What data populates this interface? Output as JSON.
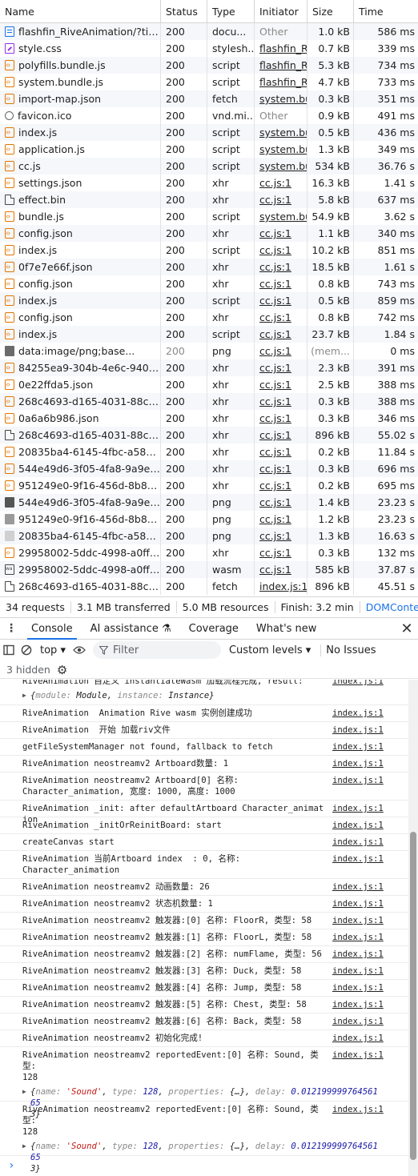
{
  "network": {
    "columns": [
      "Name",
      "Status",
      "Type",
      "Initiator",
      "Size",
      "Time"
    ],
    "rows": [
      {
        "icon": "document-icon",
        "name": "flashfin_RiveAnimation/?tim...",
        "status": "200",
        "type": "docu...",
        "initiator": "Other",
        "size": "1.0 kB",
        "time": "586 ms",
        "gray": true
      },
      {
        "icon": "css-icon",
        "name": "style.css",
        "status": "200",
        "type": "stylesh...",
        "initiator": "flashfin_Riv",
        "size": "0.7 kB",
        "time": "339 ms"
      },
      {
        "icon": "script-icon",
        "name": "polyfills.bundle.js",
        "status": "200",
        "type": "script",
        "initiator": "flashfin_Riv",
        "size": "5.3 kB",
        "time": "734 ms"
      },
      {
        "icon": "script-icon",
        "name": "system.bundle.js",
        "status": "200",
        "type": "script",
        "initiator": "flashfin_Riv",
        "size": "4.7 kB",
        "time": "733 ms"
      },
      {
        "icon": "script-icon",
        "name": "import-map.json",
        "status": "200",
        "type": "fetch",
        "initiator": "system.bun",
        "size": "0.3 kB",
        "time": "351 ms"
      },
      {
        "icon": "favicon-icon",
        "name": "favicon.ico",
        "status": "200",
        "type": "vnd.mi...",
        "initiator": "Other",
        "size": "0.9 kB",
        "time": "491 ms",
        "gray": true
      },
      {
        "icon": "script-icon",
        "name": "index.js",
        "status": "200",
        "type": "script",
        "initiator": "system.bun",
        "size": "0.5 kB",
        "time": "436 ms"
      },
      {
        "icon": "script-icon",
        "name": "application.js",
        "status": "200",
        "type": "script",
        "initiator": "system.bun",
        "size": "1.3 kB",
        "time": "349 ms"
      },
      {
        "icon": "script-icon",
        "name": "cc.js",
        "status": "200",
        "type": "script",
        "initiator": "system.bun",
        "size": "534 kB",
        "time": "36.76 s"
      },
      {
        "icon": "script-icon",
        "name": "settings.json",
        "status": "200",
        "type": "xhr",
        "initiator": "cc.js:1",
        "size": "16.3 kB",
        "time": "1.41 s"
      },
      {
        "icon": "file-icon",
        "name": "effect.bin",
        "status": "200",
        "type": "xhr",
        "initiator": "cc.js:1",
        "size": "5.8 kB",
        "time": "637 ms"
      },
      {
        "icon": "script-icon",
        "name": "bundle.js",
        "status": "200",
        "type": "script",
        "initiator": "system.bun",
        "size": "54.9 kB",
        "time": "3.62 s"
      },
      {
        "icon": "script-icon",
        "name": "config.json",
        "status": "200",
        "type": "xhr",
        "initiator": "cc.js:1",
        "size": "1.1 kB",
        "time": "340 ms"
      },
      {
        "icon": "script-icon",
        "name": "index.js",
        "status": "200",
        "type": "script",
        "initiator": "cc.js:1",
        "size": "10.2 kB",
        "time": "851 ms"
      },
      {
        "icon": "script-icon",
        "name": "0f7e7e66f.json",
        "status": "200",
        "type": "xhr",
        "initiator": "cc.js:1",
        "size": "18.5 kB",
        "time": "1.61 s"
      },
      {
        "icon": "script-icon",
        "name": "config.json",
        "status": "200",
        "type": "xhr",
        "initiator": "cc.js:1",
        "size": "0.8 kB",
        "time": "743 ms"
      },
      {
        "icon": "script-icon",
        "name": "index.js",
        "status": "200",
        "type": "script",
        "initiator": "cc.js:1",
        "size": "0.5 kB",
        "time": "859 ms"
      },
      {
        "icon": "script-icon",
        "name": "config.json",
        "status": "200",
        "type": "xhr",
        "initiator": "cc.js:1",
        "size": "0.8 kB",
        "time": "742 ms"
      },
      {
        "icon": "script-icon",
        "name": "index.js",
        "status": "200",
        "type": "script",
        "initiator": "cc.js:1",
        "size": "23.7 kB",
        "time": "1.84 s"
      },
      {
        "icon": "image-icon",
        "name": "data:image/png;base...",
        "status": "200",
        "type": "png",
        "initiator": "cc.js:1",
        "size": "(mem...",
        "time": "0 ms",
        "grayStatus": true
      },
      {
        "icon": "script-icon",
        "name": "84255ea9-304b-4e6c-940d-...",
        "status": "200",
        "type": "xhr",
        "initiator": "cc.js:1",
        "size": "2.3 kB",
        "time": "391 ms"
      },
      {
        "icon": "script-icon",
        "name": "0e22ffda5.json",
        "status": "200",
        "type": "xhr",
        "initiator": "cc.js:1",
        "size": "2.5 kB",
        "time": "388 ms"
      },
      {
        "icon": "script-icon",
        "name": "268c4693-d165-4031-88ce-...",
        "status": "200",
        "type": "xhr",
        "initiator": "cc.js:1",
        "size": "0.3 kB",
        "time": "388 ms"
      },
      {
        "icon": "script-icon",
        "name": "0a6a6b986.json",
        "status": "200",
        "type": "xhr",
        "initiator": "cc.js:1",
        "size": "0.3 kB",
        "time": "346 ms"
      },
      {
        "icon": "file-icon",
        "name": "268c4693-d165-4031-88ce-...",
        "status": "200",
        "type": "xhr",
        "initiator": "cc.js:1",
        "size": "896 kB",
        "time": "55.02 s"
      },
      {
        "icon": "script-icon",
        "name": "20835ba4-6145-4fbc-a58a-...",
        "status": "200",
        "type": "xhr",
        "initiator": "cc.js:1",
        "size": "0.2 kB",
        "time": "11.84 s"
      },
      {
        "icon": "script-icon",
        "name": "544e49d6-3f05-4fa8-9a9e-0...",
        "status": "200",
        "type": "xhr",
        "initiator": "cc.js:1",
        "size": "0.3 kB",
        "time": "696 ms"
      },
      {
        "icon": "script-icon",
        "name": "951249e0-9f16-456d-8b85-...",
        "status": "200",
        "type": "xhr",
        "initiator": "cc.js:1",
        "size": "0.2 kB",
        "time": "695 ms"
      },
      {
        "icon": "png-dark-icon",
        "name": "544e49d6-3f05-4fa8-9a9e-0...",
        "status": "200",
        "type": "png",
        "initiator": "cc.js:1",
        "size": "1.4 kB",
        "time": "23.23 s"
      },
      {
        "icon": "png-gray-icon",
        "name": "951249e0-9f16-456d-8b85-...",
        "status": "200",
        "type": "png",
        "initiator": "cc.js:1",
        "size": "1.2 kB",
        "time": "23.23 s"
      },
      {
        "icon": "png-light-icon",
        "name": "20835ba4-6145-4fbc-a58a-...",
        "status": "200",
        "type": "png",
        "initiator": "cc.js:1",
        "size": "1.3 kB",
        "time": "16.63 s"
      },
      {
        "icon": "script-icon",
        "name": "29958002-5ddc-4998-a0ff-8...",
        "status": "200",
        "type": "xhr",
        "initiator": "cc.js:1",
        "size": "0.3 kB",
        "time": "132 ms"
      },
      {
        "icon": "wasm-icon",
        "name": "29958002-5ddc-4998-a0ff-8...",
        "status": "200",
        "type": "wasm",
        "initiator": "cc.js:1",
        "size": "585 kB",
        "time": "37.87 s"
      },
      {
        "icon": "file-icon",
        "name": "268c4693-d165-4031-88ce-...",
        "status": "200",
        "type": "fetch",
        "initiator": "index.js:1",
        "size": "896 kB",
        "time": "45.51 s"
      }
    ],
    "summary": [
      "34 requests",
      "3.1 MB transferred",
      "5.0 MB resources",
      "Finish: 3.2 min",
      "DOMContentL"
    ]
  },
  "tabs": {
    "items": [
      "Console",
      "AI assistance",
      "Coverage",
      "What's new"
    ],
    "active": "Console",
    "ai_suffix": "⚗"
  },
  "toolbar": {
    "context": "top",
    "filter_placeholder": "Filter",
    "levels": "Custom levels",
    "issues": "No Issues",
    "hidden": "3 hidden"
  },
  "console": {
    "messages": [
      {
        "text": "RiveAnimation 自定义 instantiateWasm 加载流程完成, result:",
        "obj": "{module: Module, instance: Instance}",
        "src": "index.js:1",
        "cut": true
      },
      {
        "text": "RiveAnimation  Animation Rive wasm 实例创建成功",
        "src": "index.js:1"
      },
      {
        "text": "RiveAnimation  开始 加载riv文件",
        "src": "index.js:1"
      },
      {
        "text": "getFileSystemManager not found, fallback to fetch",
        "src": "index.js:1"
      },
      {
        "text": "RiveAnimation neostreamv2 Artboard数量: 1",
        "src": "index.js:1"
      },
      {
        "text": "RiveAnimation neostreamv2 Artboard[0] 名称:\nCharacter_animation, 宽度: 1000, 高度: 1000",
        "src": "index.js:1"
      },
      {
        "text": "RiveAnimation _init: after defaultArtboard Character_animation",
        "src": "index.js:1"
      },
      {
        "text": "RiveAnimation _initOrReinitBoard: start",
        "src": "index.js:1"
      },
      {
        "text": "createCanvas start",
        "src": "index.js:1"
      },
      {
        "text": "RiveAnimation 当前Artboard index  : 0, 名称:\nCharacter_animation",
        "src": "index.js:1"
      },
      {
        "text": "RiveAnimation neostreamv2 动画数量: 26",
        "src": "index.js:1"
      },
      {
        "text": "RiveAnimation neostreamv2 状态机数量: 1",
        "src": "index.js:1"
      },
      {
        "text": "RiveAnimation neostreamv2 触发器:[0] 名称: FloorR, 类型: 58",
        "src": "index.js:1"
      },
      {
        "text": "RiveAnimation neostreamv2 触发器:[1] 名称: FloorL, 类型: 58",
        "src": "index.js:1"
      },
      {
        "text": "RiveAnimation neostreamv2 触发器:[2] 名称: numFlame, 类型: 56",
        "src": "index.js:1"
      },
      {
        "text": "RiveAnimation neostreamv2 触发器:[3] 名称: Duck, 类型: 58",
        "src": "index.js:1"
      },
      {
        "text": "RiveAnimation neostreamv2 触发器:[4] 名称: Jump, 类型: 58",
        "src": "index.js:1"
      },
      {
        "text": "RiveAnimation neostreamv2 触发器:[5] 名称: Chest, 类型: 58",
        "src": "index.js:1"
      },
      {
        "text": "RiveAnimation neostreamv2 触发器:[6] 名称: Back, 类型: 58",
        "src": "index.js:1"
      },
      {
        "text": "RiveAnimation neostreamv2 初始化完成!",
        "src": "index.js:1"
      },
      {
        "text": "RiveAnimation neostreamv2 reportedEvent:[0] 名称: Sound, 类型:\n128",
        "obj": "{name: 'Sound', type: 128, properties: {…}, delay: 0.01219999976456165\n3}",
        "src": "index.js:1"
      },
      {
        "text": "RiveAnimation neostreamv2 reportedEvent:[0] 名称: Sound, 类型:\n128",
        "obj": "{name: 'Sound', type: 128, properties: {…}, delay: 0.01219999976456165\n3}",
        "src": "index.js:1"
      }
    ],
    "prompt": "›"
  }
}
